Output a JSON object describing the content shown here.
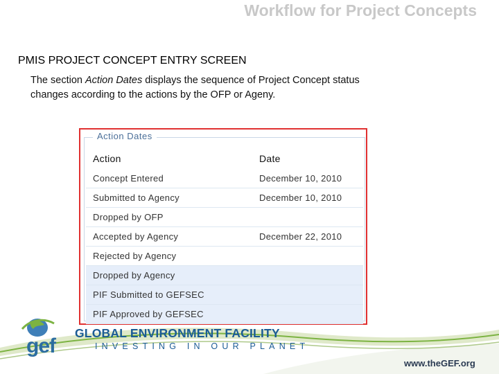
{
  "slide": {
    "title": "Workflow for Project Concepts",
    "heading": "PMIS PROJECT CONCEPT ENTRY SCREEN",
    "description": {
      "part1": "The section ",
      "emphasis": "Action Dates",
      "part2": " displays the sequence of Project Concept status changes according to the actions by the OFP or Ageny."
    }
  },
  "action_dates": {
    "legend": "Action Dates",
    "columns": {
      "action": "Action",
      "date": "Date"
    },
    "rows": [
      {
        "action": "Concept Entered",
        "date": "December 10, 2010"
      },
      {
        "action": "Submitted to Agency",
        "date": "December 10, 2010"
      },
      {
        "action": "Dropped by OFP",
        "date": ""
      },
      {
        "action": "Accepted by Agency",
        "date": "December 22, 2010"
      },
      {
        "action": "Rejected by Agency",
        "date": ""
      },
      {
        "action": "Dropped by Agency",
        "date": ""
      },
      {
        "action": "PIF Submitted to GEFSEC",
        "date": ""
      },
      {
        "action": "PIF Approved by GEFSEC",
        "date": ""
      }
    ]
  },
  "footer": {
    "logo_text": "gef",
    "org_name": "GLOBAL ENVIRONMENT FACILITY",
    "tagline": "INVESTING IN OUR PLANET",
    "url": "www.theGEF.org"
  },
  "colors": {
    "title_gray": "#c8c8c8",
    "highlight_border": "#e03030",
    "legend_blue": "#4b6f99",
    "row_shade": "#e6eefa",
    "brand_blue": "#1b5c95",
    "brand_green": "#7cb342"
  },
  "icons": {
    "logo": "gef-globe-icon"
  }
}
